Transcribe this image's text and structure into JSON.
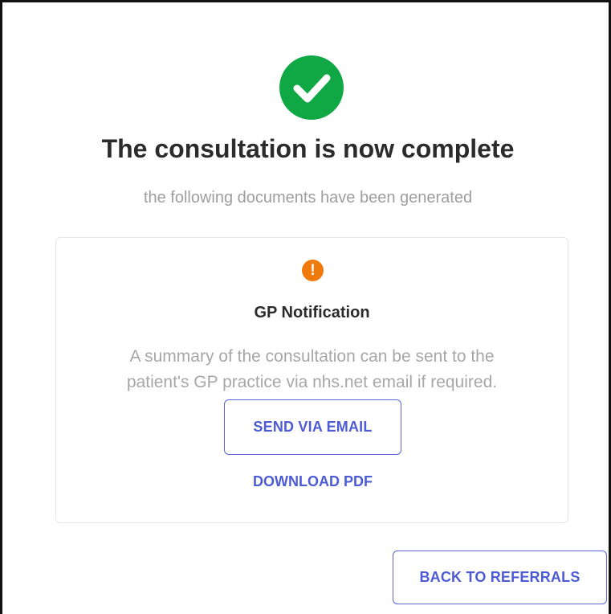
{
  "icons": {
    "success": "check-circle-icon",
    "warning": "exclamation-circle-icon",
    "warning_glyph": "!"
  },
  "colors": {
    "success": "#10a844",
    "warning": "#f07a0c",
    "accent": "#4d5bd6",
    "title": "#2b2b2b",
    "muted": "#9e9e9e"
  },
  "header": {
    "title": "The consultation is now complete",
    "subtitle": "the following documents have been generated"
  },
  "card": {
    "title": "GP Notification",
    "description_line1": "A summary of the consultation can be sent to the",
    "description_line2": "patient's GP practice via nhs.net email if required.",
    "send_button_label": "SEND VIA EMAIL",
    "download_label": "DOWNLOAD PDF"
  },
  "footer": {
    "back_button_label": "BACK TO REFERRALS"
  }
}
